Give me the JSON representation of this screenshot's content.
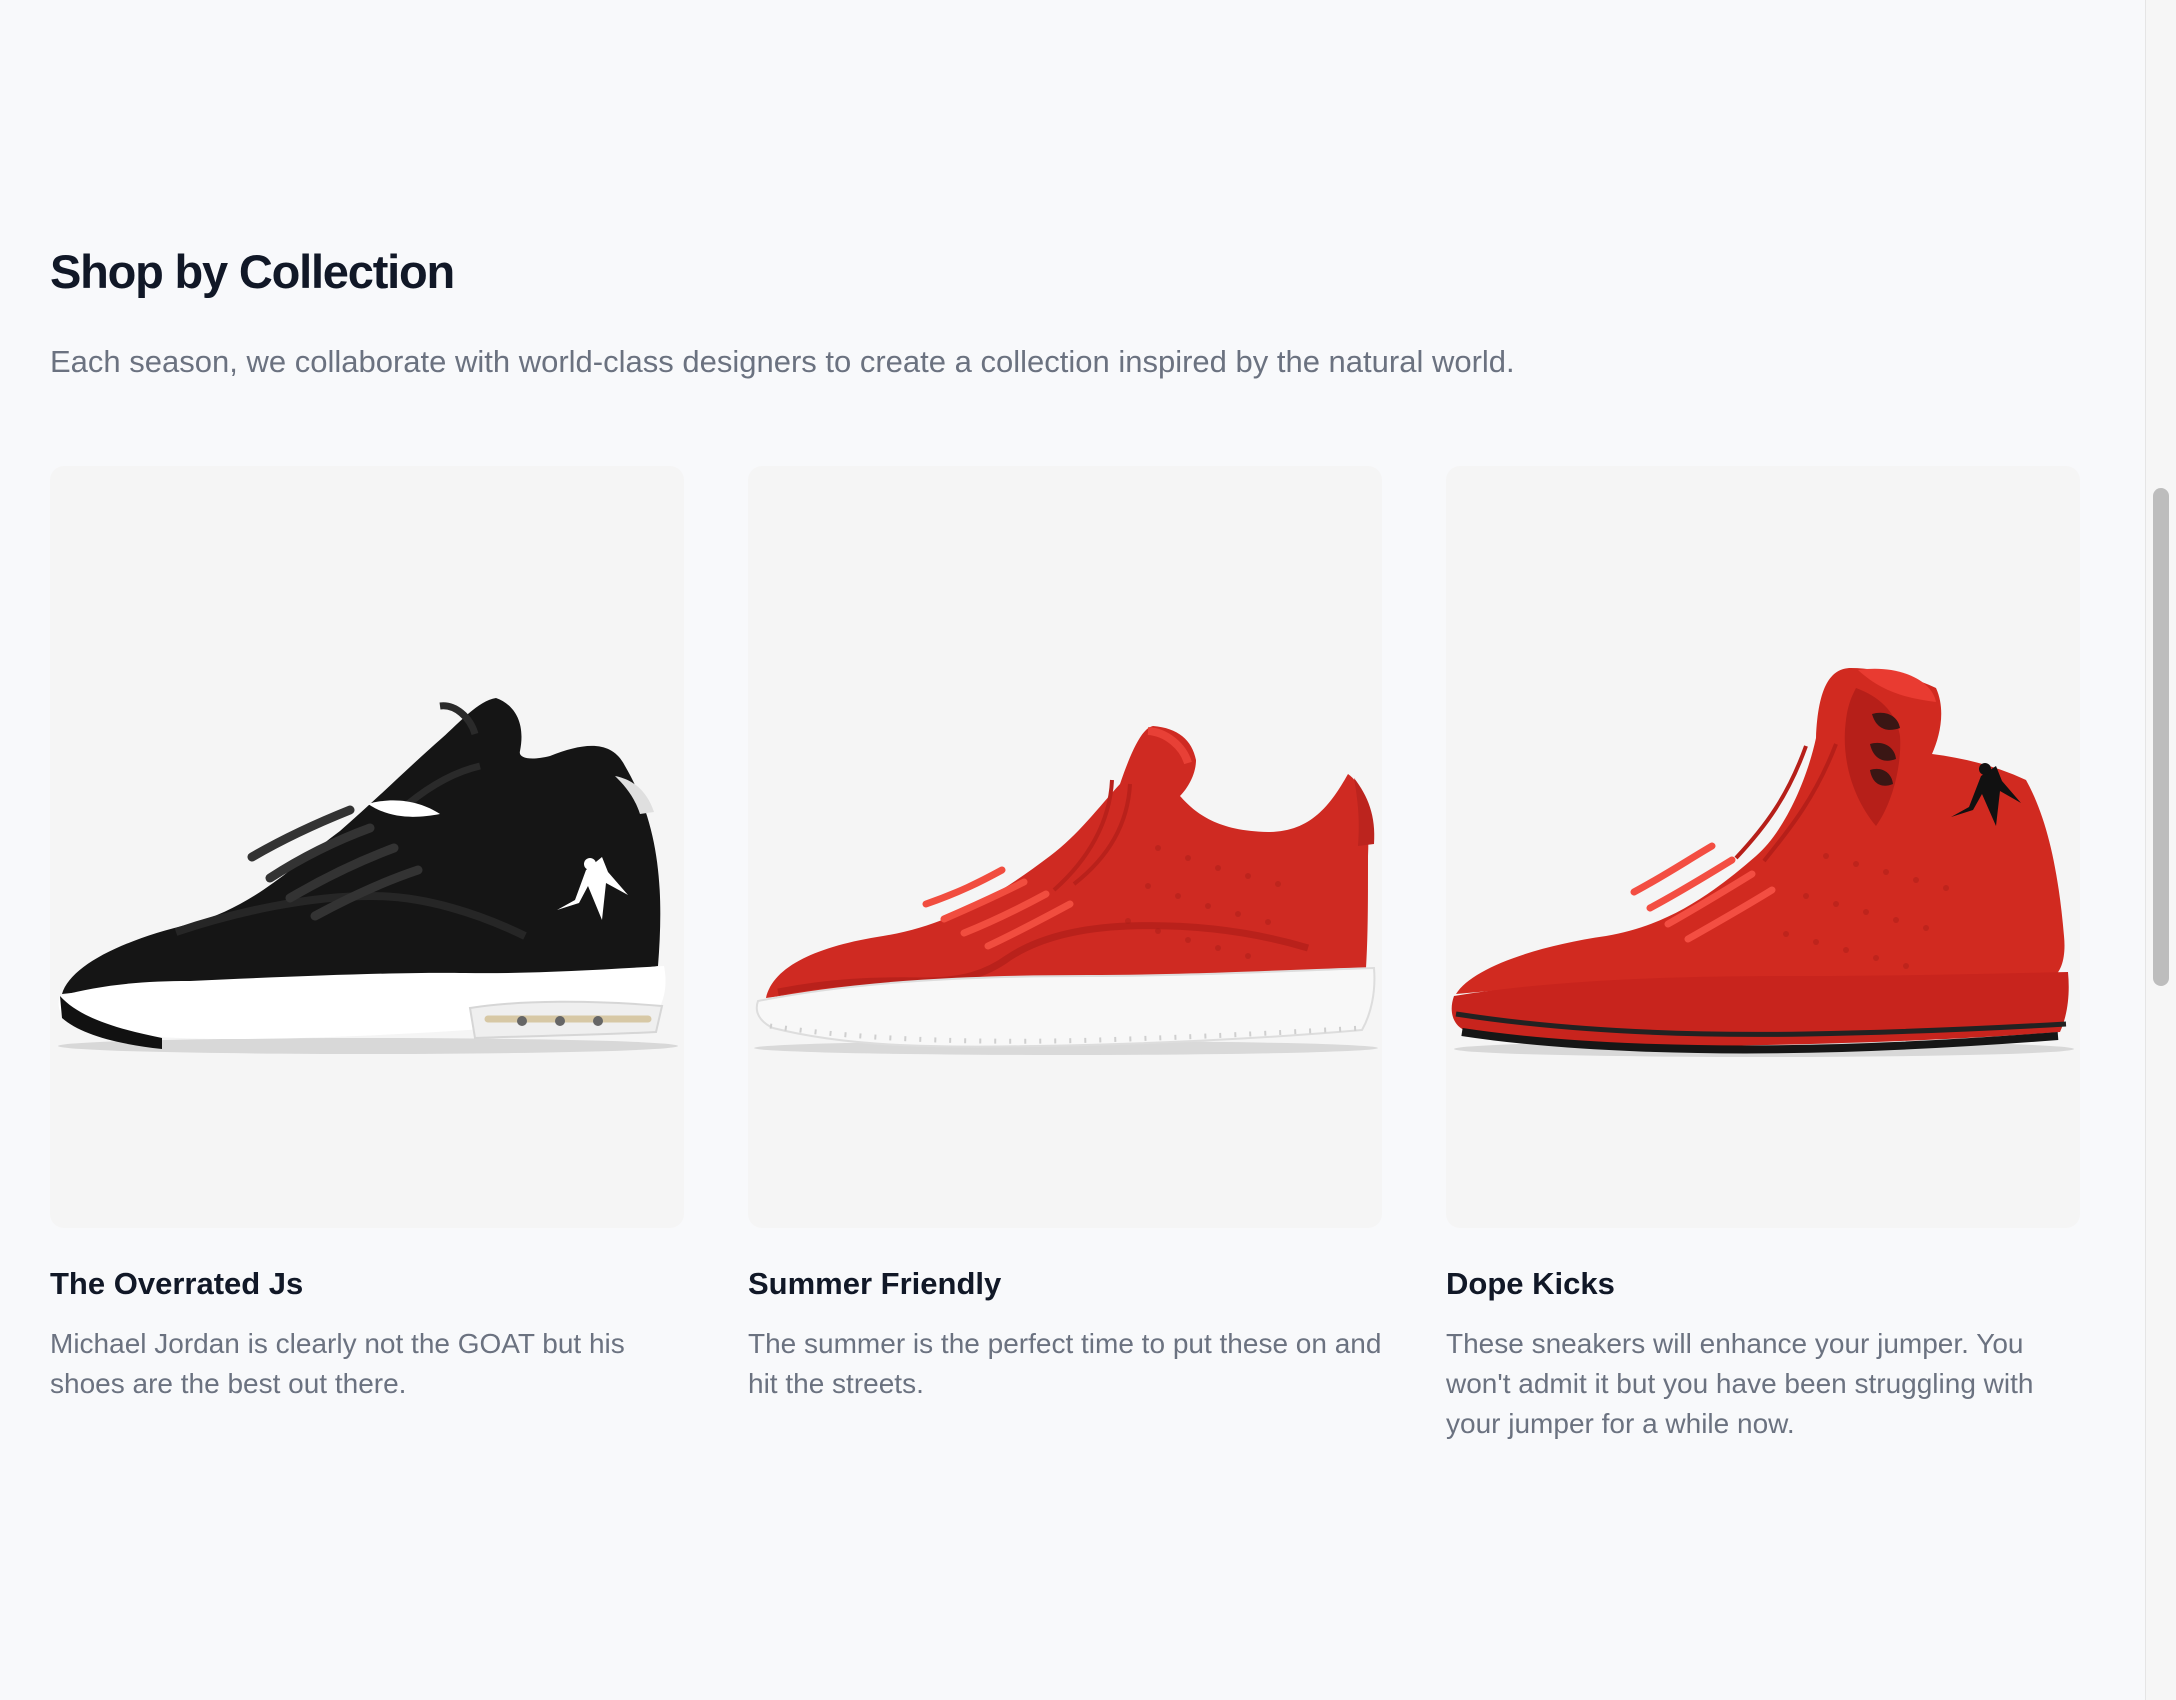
{
  "header": {
    "title": "Shop by Collection",
    "subtitle": "Each season, we collaborate with world-class designers to create a collection inspired by the natural world."
  },
  "collections": [
    {
      "title": "The Overrated Js",
      "description": "Michael Jordan is clearly not the GOAT but his shoes are the best out there.",
      "image": "black-white-sneaker-image",
      "color": "#111111"
    },
    {
      "title": "Summer Friendly",
      "description": "The summer is the perfect time to put these on and hit the streets.",
      "image": "red-low-sneaker-image",
      "color": "#c92822"
    },
    {
      "title": "Dope Kicks",
      "description": "These sneakers will enhance your jumper. You won't admit it but you have been struggling with your jumper for a while now.",
      "image": "red-high-sneaker-image",
      "color": "#d0291f"
    }
  ],
  "colors": {
    "page_background": "#f8f9fb",
    "image_background": "#f5f5f5",
    "heading": "#111827",
    "body_text": "#6b7280",
    "scrollbar_thumb": "#bdbdbd"
  }
}
